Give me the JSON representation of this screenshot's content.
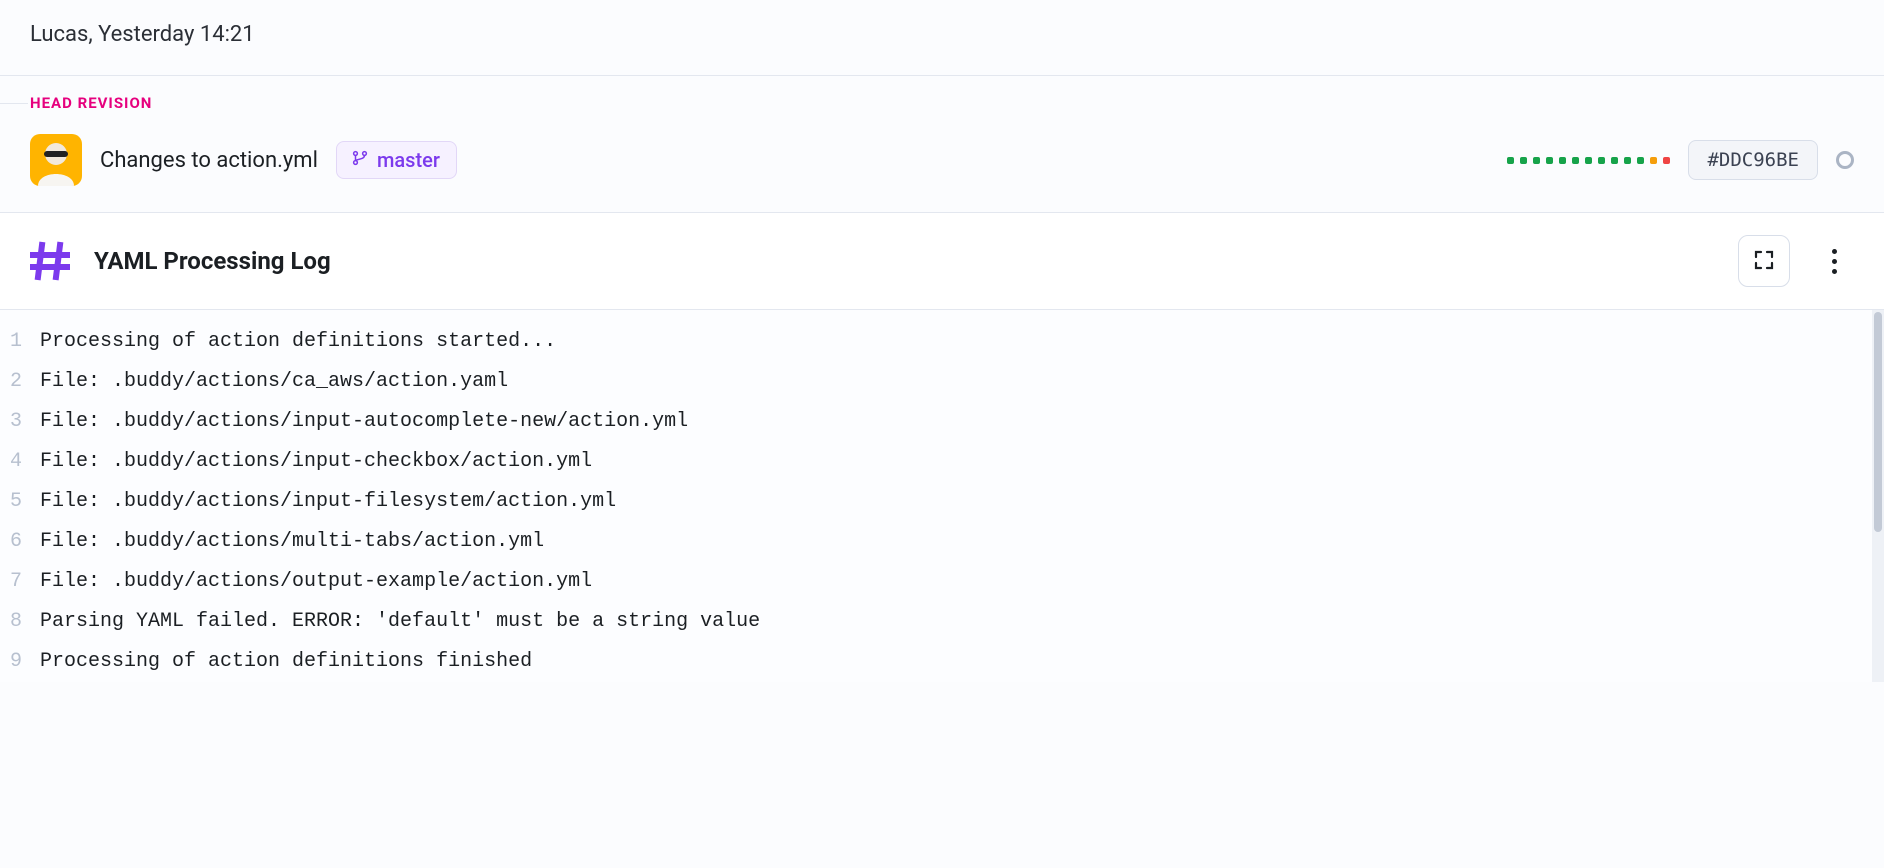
{
  "author_row": {
    "text": "Lucas, Yesterday 14:21"
  },
  "head_label": "HEAD REVISION",
  "commit": {
    "title": "Changes to action.yml",
    "branch": "master",
    "sha": "#DDC96BE",
    "status_dots": [
      "#16a34a",
      "#16a34a",
      "#16a34a",
      "#16a34a",
      "#16a34a",
      "#16a34a",
      "#16a34a",
      "#16a34a",
      "#16a34a",
      "#16a34a",
      "#16a34a",
      "#f59e0b",
      "#ef4444"
    ]
  },
  "log_panel": {
    "title": "YAML Processing Log",
    "lines": [
      "Processing of action definitions started...",
      "File: .buddy/actions/ca_aws/action.yaml",
      "File: .buddy/actions/input-autocomplete-new/action.yml",
      "File: .buddy/actions/input-checkbox/action.yml",
      "File: .buddy/actions/input-filesystem/action.yml",
      "File: .buddy/actions/multi-tabs/action.yml",
      "File: .buddy/actions/output-example/action.yml",
      "Parsing YAML failed. ERROR: 'default' must be a string value",
      "Processing of action definitions finished"
    ]
  }
}
